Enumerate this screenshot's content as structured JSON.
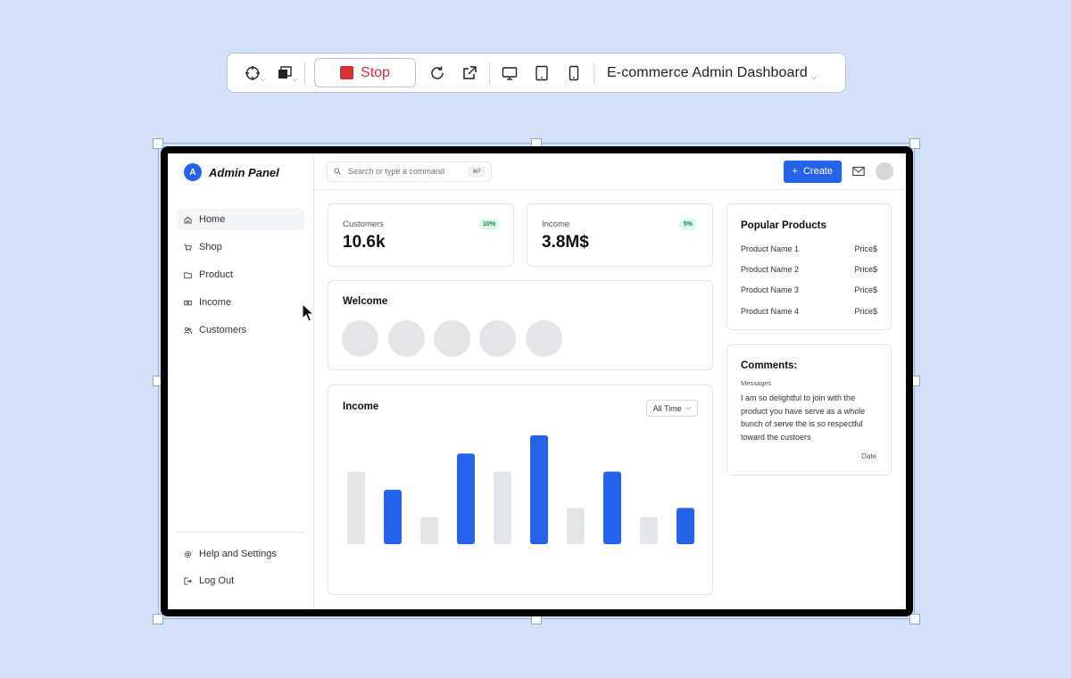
{
  "toolbar": {
    "stop_label": "Stop",
    "title": "E-commerce Admin Dashboard"
  },
  "sidebar": {
    "brand_initial": "A",
    "brand_name": "Admin Panel",
    "items": [
      {
        "label": "Home",
        "icon": "home-icon",
        "active": true
      },
      {
        "label": "Shop",
        "icon": "cart-icon"
      },
      {
        "label": "Product",
        "icon": "folder-icon"
      },
      {
        "label": "Income",
        "icon": "money-icon"
      },
      {
        "label": "Customers",
        "icon": "users-icon"
      }
    ],
    "bottom_items": [
      {
        "label": "Help and Settings",
        "icon": "gear-icon"
      },
      {
        "label": "Log Out",
        "icon": "logout-icon"
      }
    ]
  },
  "topbar": {
    "search_placeholder": "Search or type a command",
    "search_shortcut": "⌘F",
    "create_label": "Create"
  },
  "stats": [
    {
      "label": "Customers",
      "value": "10.6k",
      "badge": "10%"
    },
    {
      "label": "Income",
      "value": "3.8M$",
      "badge": "5%"
    }
  ],
  "welcome": {
    "title": "Welcome",
    "avatar_count": 5
  },
  "income_card": {
    "title": "Income",
    "filter_label": "All Time"
  },
  "chart_data": {
    "type": "bar",
    "categories": [
      "",
      "",
      "",
      "",
      "",
      "",
      "",
      "",
      "",
      ""
    ],
    "values": [
      8,
      6,
      3,
      10,
      8,
      12,
      4,
      8,
      3,
      4
    ],
    "highlight": [
      false,
      true,
      false,
      true,
      false,
      true,
      false,
      true,
      false,
      true
    ],
    "colors": {
      "highlight": "#2563eb",
      "muted": "#e5e6e9"
    },
    "ylim": [
      0,
      12
    ]
  },
  "popular_products": {
    "title": "Popular Products",
    "items": [
      {
        "name": "Product Name 1",
        "price": "Price$"
      },
      {
        "name": "Product Name 2",
        "price": "Price$"
      },
      {
        "name": "Product Name 3",
        "price": "Price$"
      },
      {
        "name": "Product Name 4",
        "price": "Price$"
      }
    ]
  },
  "comments": {
    "title": "Comments:",
    "subtitle": "Messages",
    "body": "I am so delightful to join with the product you have serve as a whole bunch of serve the is so respectful toward the custoers",
    "date": "Date"
  },
  "colors": {
    "accent": "#2563eb",
    "stop": "#d92f36",
    "badge_bg": "#dcfce7",
    "badge_text": "#15803d"
  }
}
